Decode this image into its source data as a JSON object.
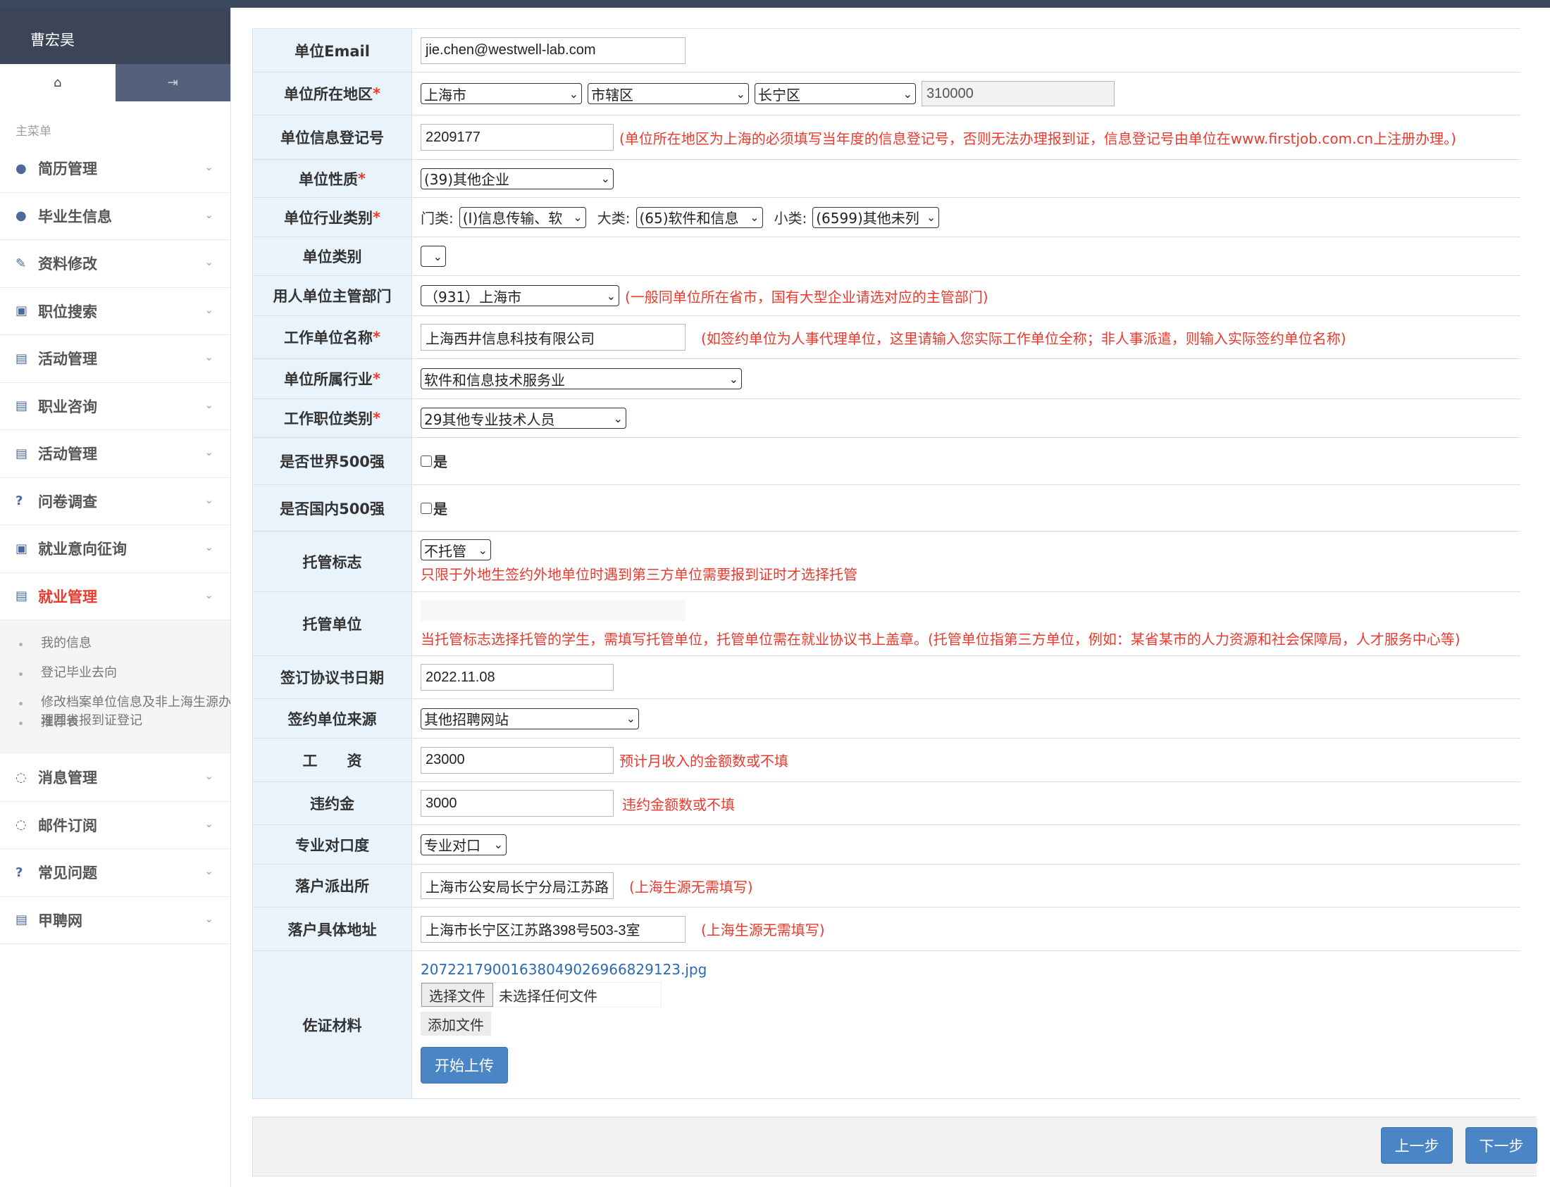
{
  "user": {
    "name": "曹宏昊"
  },
  "sidebar": {
    "tabs": [
      {
        "icon": "home-icon",
        "glyph": "⌂"
      },
      {
        "icon": "logout-icon",
        "glyph": "⇥"
      }
    ],
    "caption": "主菜单",
    "items": [
      {
        "label": "简历管理",
        "icon": "user-icon",
        "glyph": "●"
      },
      {
        "label": "毕业生信息",
        "icon": "user-icon",
        "glyph": "●"
      },
      {
        "label": "资料修改",
        "icon": "pencil-icon",
        "glyph": "✎"
      },
      {
        "label": "职位搜索",
        "icon": "briefcase-icon",
        "glyph": "▣"
      },
      {
        "label": "活动管理",
        "icon": "building-icon",
        "glyph": "▤"
      },
      {
        "label": "职业咨询",
        "icon": "building-icon",
        "glyph": "▤"
      },
      {
        "label": "活动管理",
        "icon": "building-icon",
        "glyph": "▤"
      },
      {
        "label": "问卷调查",
        "icon": "question-icon",
        "glyph": "?"
      },
      {
        "label": "就业意向征询",
        "icon": "briefcase-icon",
        "glyph": "▣"
      },
      {
        "label": "就业管理",
        "icon": "building-icon",
        "glyph": "▤"
      },
      {
        "label": "消息管理",
        "icon": "comments-icon",
        "glyph": "◌"
      },
      {
        "label": "邮件订阅",
        "icon": "comments-icon",
        "glyph": "◌"
      },
      {
        "label": "常见问题",
        "icon": "question-icon",
        "glyph": "?"
      },
      {
        "label": "甲聘网",
        "icon": "building-icon",
        "glyph": "▤"
      }
    ],
    "submenu": [
      "我的信息",
      "登记毕业去向",
      "修改档案单位信息及非上海生源办理回省报到证登记",
      "推荐表"
    ]
  },
  "form": {
    "email": {
      "label": "单位Email",
      "value": "jie.chen@westwell-lab.com"
    },
    "region": {
      "label": "单位所在地区",
      "province": "上海市",
      "city": "市辖区",
      "district": "长宁区",
      "postcode": "310000"
    },
    "regno": {
      "label": "单位信息登记号",
      "value": "2209177",
      "hint": "(单位所在地区为上海的必须填写当年度的信息登记号，否则无法办理报到证，信息登记号由单位在www.firstjob.com.cn上注册办理。)"
    },
    "nature": {
      "label": "单位性质",
      "value": "(39)其他企业"
    },
    "industry": {
      "label": "单位行业类别",
      "men_label": "门类:",
      "men": "(I)信息传输、软",
      "da_label": "大类:",
      "da": "(65)软件和信息",
      "xiao_label": "小类:",
      "xiao": "(6599)其他未列"
    },
    "category": {
      "label": "单位类别",
      "value": ""
    },
    "dept": {
      "label": "用人单位主管部门",
      "value": "（931）上海市",
      "hint": "(一般同单位所在省市，国有大型企业请选对应的主管部门)"
    },
    "workname": {
      "label": "工作单位名称",
      "value": "上海西井信息科技有限公司",
      "hint": "(如签约单位为人事代理单位，这里请输入您实际工作单位全称；非人事派遣，则输入实际签约单位名称)"
    },
    "belong": {
      "label": "单位所属行业",
      "value": "软件和信息技术服务业"
    },
    "jobtype": {
      "label": "工作职位类别",
      "value": "29其他专业技术人员"
    },
    "world500": {
      "label": "是否世界500强",
      "option": "是"
    },
    "china500": {
      "label": "是否国内500强",
      "option": "是"
    },
    "trust": {
      "label": "托管标志",
      "value": "不托管",
      "hint": "只限于外地生签约外地单位时遇到第三方单位需要报到证时才选择托管"
    },
    "trustunit": {
      "label": "托管单位",
      "value": "",
      "hint": "当托管标志选择托管的学生，需填写托管单位，托管单位需在就业协议书上盖章。(托管单位指第三方单位，例如：某省某市的人力资源和社会保障局，人才服务中心等)"
    },
    "signdate": {
      "label": "签订协议书日期",
      "value": "2022.11.08"
    },
    "source": {
      "label": "签约单位来源",
      "value": "其他招聘网站"
    },
    "salary": {
      "label": "工　　资",
      "value": "23000",
      "hint": "预计月收入的金额数或不填"
    },
    "penalty": {
      "label": "违约金",
      "value": "3000",
      "hint": "违约金额数或不填"
    },
    "match": {
      "label": "专业对口度",
      "value": "专业对口"
    },
    "police": {
      "label": "落户派出所",
      "value": "上海市公安局长宁分局江苏路",
      "hint": "(上海生源无需填写)"
    },
    "address": {
      "label": "落户具体地址",
      "value": "上海市长宁区江苏路398号503-3室",
      "hint": "(上海生源无需填写)"
    },
    "evidence": {
      "label": "佐证材料",
      "file_link": "2072217900163804902696682912​3.jpg",
      "choose_btn": "选择文件",
      "no_file": "未选择任何文件",
      "add_btn": "添加文件",
      "upload_btn": "开始上传"
    }
  },
  "footer": {
    "prev": "上一步",
    "next": "下一步"
  }
}
